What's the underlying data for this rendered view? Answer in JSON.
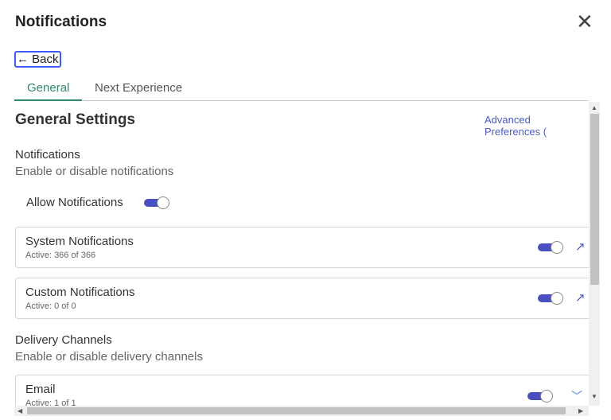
{
  "header": {
    "title": "Notifications",
    "close_icon": "close-icon",
    "back_label": "← Back"
  },
  "tabs": [
    {
      "label": "General",
      "active": true
    },
    {
      "label": "Next Experience",
      "active": false
    }
  ],
  "content": {
    "heading": "General Settings",
    "advanced_link": "Advanced Preferences",
    "notifications": {
      "title": "Notifications",
      "subtitle": "Enable or disable notifications",
      "allow_label": "Allow Notifications",
      "allow_on": true
    },
    "cards": [
      {
        "name": "System Notifications",
        "meta": "Active: 366 of 366",
        "on": true
      },
      {
        "name": "Custom Notifications",
        "meta": "Active: 0 of 0",
        "on": true
      }
    ],
    "delivery": {
      "title": "Delivery Channels",
      "subtitle": "Enable or disable delivery channels"
    },
    "email": {
      "name": "Email",
      "meta": "Active: 1 of 1",
      "on": true
    }
  },
  "colors": {
    "accent": "#4a4fc0",
    "tab_active": "#2e8b6a",
    "link": "#4a5bc4"
  }
}
